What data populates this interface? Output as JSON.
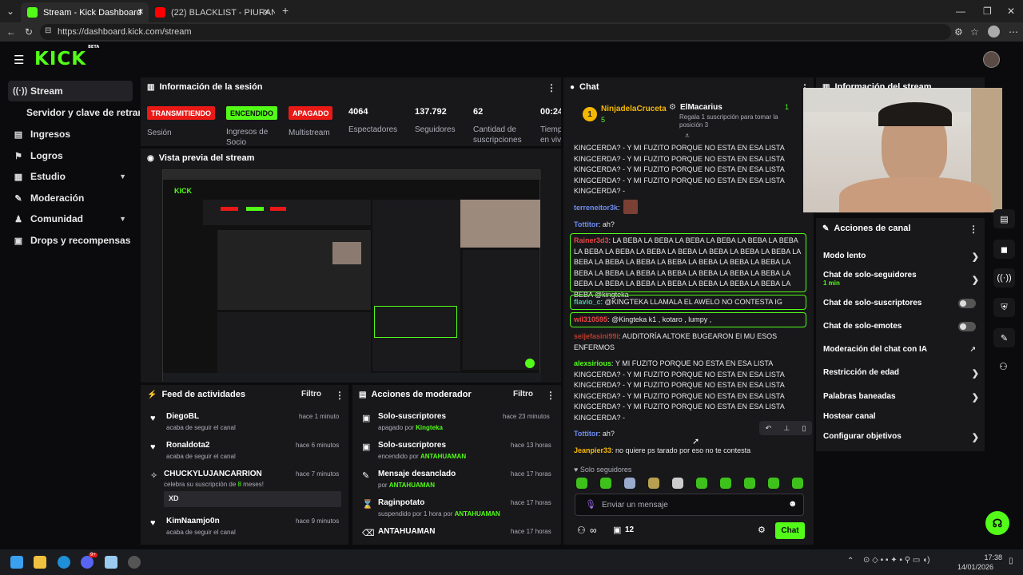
{
  "browser": {
    "tabs": [
      {
        "title": "Stream - Kick Dashboard",
        "active": true
      },
      {
        "title": "(22) BLACKLIST - PIURANO 27(PR",
        "active": false
      }
    ],
    "url": "https://dashboard.kick.com/stream",
    "new_tab": "+",
    "close": "✕"
  },
  "header": {
    "logo": "KICK",
    "logo_sup": "BETA"
  },
  "sidebar": {
    "items": [
      {
        "label": "Stream",
        "icon": "stream-icon",
        "active": true
      },
      {
        "label": "Servidor y clave de retransmisión",
        "icon": "",
        "active": false
      },
      {
        "label": "Ingresos",
        "icon": "chart-icon"
      },
      {
        "label": "Logros",
        "icon": "flag-icon"
      },
      {
        "label": "Estudio",
        "icon": "grid-icon",
        "chevron": true
      },
      {
        "label": "Moderación",
        "icon": "wrench-icon"
      },
      {
        "label": "Comunidad",
        "icon": "people-icon",
        "chevron": true
      },
      {
        "label": "Drops y recompensas",
        "icon": "gift-icon"
      }
    ]
  },
  "session": {
    "title": "Información de la sesión",
    "badges": [
      {
        "text": "TRANSMITIENDO",
        "label": "Sesión",
        "bg": "#e91916",
        "fg": "#ffffff"
      },
      {
        "text": "ENCENDIDO",
        "label": "Ingresos de Socio",
        "bg": "#53fc18",
        "fg": "#0b0b0d"
      },
      {
        "text": "APAGADO",
        "label": "Multistream",
        "bg": "#e91916",
        "fg": "#ffffff"
      }
    ],
    "stats": [
      {
        "value": "4064",
        "label": "Espectadores"
      },
      {
        "value": "137.792",
        "label": "Seguidores"
      },
      {
        "value": "62",
        "label": "Cantidad de suscripciones"
      },
      {
        "value": "00:24",
        "label": "Tiempo en vivo"
      }
    ]
  },
  "preview": {
    "title": "Vista previa del stream"
  },
  "feed": {
    "title": "Feed de actividades",
    "filter": "Filtro",
    "items": [
      {
        "name": "DiegoBL",
        "sub": "acaba de seguir el canal",
        "time": "hace 1 minuto",
        "icon": "heart-icon"
      },
      {
        "name": "Ronaldota2",
        "sub": "acaba de seguir el canal",
        "time": "hace 6 minutos",
        "icon": "heart-icon"
      },
      {
        "name": "CHUCKYLUJANCARRION",
        "sub_pre": "celebra su suscripción de ",
        "sub_num": "8",
        "sub_post": " meses!",
        "time": "hace 7 minutos",
        "icon": "star-icon",
        "message": "XD"
      },
      {
        "name": "KimNaamjo0n",
        "sub": "acaba de seguir el canal",
        "time": "hace 9 minutos",
        "icon": "heart-icon"
      }
    ]
  },
  "modactions": {
    "title": "Acciones de moderador",
    "filter": "Filtro",
    "items": [
      {
        "name": "Solo-suscriptores",
        "sub_pre": "apagado por ",
        "sub_user": "Kingteka",
        "time": "hace 23 minutos",
        "icon": "gift-icon"
      },
      {
        "name": "Solo-suscriptores",
        "sub_pre": "encendido por ",
        "sub_user": "ANTAHUAMAN",
        "time": "hace 13 horas",
        "icon": "gift-icon"
      },
      {
        "name": "Mensaje desanclado",
        "sub_pre": "por ",
        "sub_user": "ANTAHUAMAN",
        "time": "hace 17 horas",
        "icon": "pin-icon"
      },
      {
        "name": "Raginpotato",
        "sub_pre": "suspendido por 1 hora por ",
        "sub_user": "ANTAHUAMAN",
        "time": "hace 17 horas",
        "icon": "hourglass-icon"
      },
      {
        "name": "ANTAHUAMAN",
        "sub_pre": "",
        "sub_user": "",
        "time": "hace 17 horas",
        "icon": "trash-icon"
      }
    ]
  },
  "chat": {
    "title": "Chat",
    "top_gifter": {
      "rank": "1",
      "name": "NinjadelaCruceta",
      "count": "5"
    },
    "second": {
      "name": "ElMacarius",
      "sub": "Regala 1 suscripción para tomar la posición 3",
      "count": "1"
    },
    "messages": [
      {
        "user": "",
        "text": "KINGCERDA? - Y MI FUZITO PORQUE NO ESTA EN ESA LISTA"
      },
      {
        "user": "",
        "text": "KINGCERDA? - Y MI FUZITO PORQUE NO ESTA EN ESA LISTA"
      },
      {
        "user": "",
        "text": "KINGCERDA? - Y MI FUZITO PORQUE NO ESTA EN ESA LISTA"
      },
      {
        "user": "",
        "text": "KINGCERDA? - Y MI FUZITO PORQUE NO ESTA EN ESA LISTA"
      },
      {
        "user": "",
        "text": "KINGCERDA? -"
      },
      {
        "user": "terreneitor3k",
        "text": ""
      },
      {
        "user": "Tottitor",
        "text": "ah?"
      },
      {
        "user": "Rainer3d3",
        "text": "LA BEBA LA BEBA LA BEBA LA BEBA LA BEBA LA BEBA LA BEBA LA BEBA LA BEBA LA BEBA LA BEBA LA BEBA LA BEBA LA BEBA LA BEBA LA BEBA LA BEBA LA BEBA LA BEBA LA BEBA LA BEBA LA BEBA LA BEBA LA BEBA LA BEBA LA BEBA LA BEBA LA BEBA LA BEBA LA BEBA LA BEBA LA BEBA LA BEBA LA BEBA LA BEBA @kingteka"
      },
      {
        "user": "flavio_c",
        "text": "@KINGTEKA LLAMALA EL AWELO NO CONTESTA IG"
      },
      {
        "user": "wil310595",
        "text": "@Kingteka k1 , kotaro , lumpy ,"
      },
      {
        "user": "seijefasini99i",
        "text": "AUDITORÍA ALTOKE BUGEARON El MU ESOS ENFERMOS"
      },
      {
        "user": "alexsirious",
        "text": "Y MI FUZITO PORQUE NO ESTA EN ESA LISTA KINGCERDA? - Y MI FUZITO PORQUE NO ESTA EN ESA LISTA KINGCERDA? - Y MI FUZITO PORQUE NO ESTA EN ESA LISTA KINGCERDA? - Y MI FUZITO PORQUE NO ESTA EN ESA LISTA KINGCERDA? - Y MI FUZITO PORQUE NO ESTA EN ESA LISTA KINGCERDA? -"
      },
      {
        "user": "Tottitor",
        "text": "ah?"
      },
      {
        "user": "Jeanpier33",
        "text": "no quiere ps tarado por eso no te contesta"
      }
    ],
    "followers_only": "Solo seguidores",
    "input_placeholder": "Enviar un mensaje",
    "infinity": "∞",
    "count": "12",
    "send_label": "Chat"
  },
  "stream_info": {
    "title": "Información del stream"
  },
  "channel_actions": {
    "title": "Acciones de canal",
    "items": [
      {
        "label": "Modo lento",
        "type": "chevron"
      },
      {
        "label": "Chat de solo-seguidores",
        "sub": "1 min",
        "type": "chevron"
      },
      {
        "label": "Chat de solo-suscriptores",
        "type": "toggle"
      },
      {
        "label": "Chat de solo-emotes",
        "type": "toggle"
      },
      {
        "label": "Moderación del chat con IA",
        "type": "external"
      },
      {
        "label": "Restricción de edad",
        "type": "chevron"
      },
      {
        "label": "Palabras baneadas",
        "type": "chevron"
      },
      {
        "label": "Hostear canal",
        "type": "none"
      },
      {
        "label": "Configurar objetivos",
        "type": "chevron"
      }
    ]
  },
  "taskbar": {
    "time": "17:38",
    "date": "14/01/2026",
    "badge": "9+"
  },
  "colors": {
    "accent": "#53fc18",
    "panel": "#18181b",
    "bg": "#0b0b0d",
    "red": "#e91916"
  }
}
